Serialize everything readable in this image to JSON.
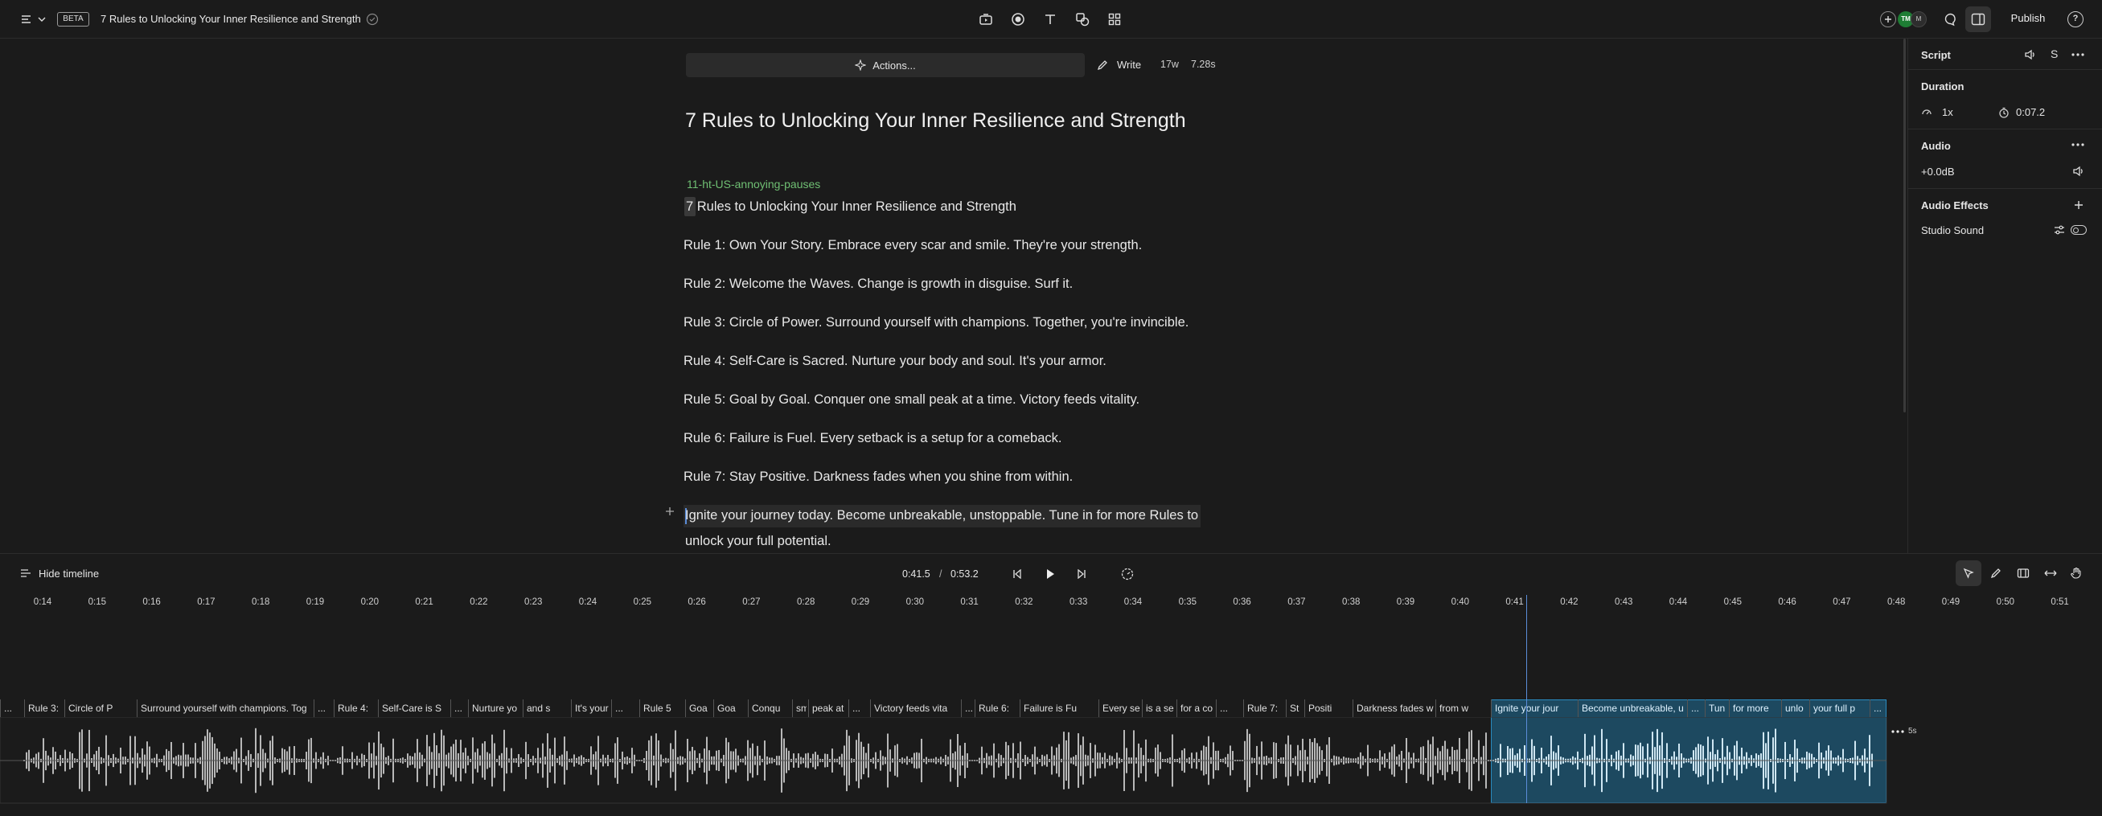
{
  "header": {
    "beta_badge": "BETA",
    "doc_title": "7 Rules to Unlocking Your Inner Resilience and Strength",
    "avatar1": "TM",
    "avatar2": "M",
    "publish_label": "Publish",
    "help_label": "?"
  },
  "actionbar": {
    "actions_label": "Actions...",
    "write_label": "Write",
    "word_count": "17w",
    "duration": "7.28s"
  },
  "document": {
    "title": "7 Rules to Unlocking Your Inner Resilience and Strength",
    "speaker": "11-ht-US-annoying-pauses",
    "lines": [
      "7 Rules to Unlocking Your Inner Resilience and Strength",
      "Rule 1: Own Your Story. Embrace every scar and smile. They're your strength.",
      "Rule 2: Welcome the Waves. Change is growth in disguise. Surf it.",
      "Rule 3: Circle of Power. Surround yourself with champions. Together, you're invincible.",
      "Rule 4: Self-Care is Sacred. Nurture your body and soul. It's your armor.",
      "Rule 5: Goal by Goal. Conquer one small peak at a time. Victory feeds vitality.",
      "Rule 6: Failure is Fuel. Every setback is a setup for a comeback.",
      "Rule 7: Stay Positive. Darkness fades when you shine from within."
    ],
    "last_line_1": "Ignite your journey today. Become unbreakable, unstoppable. Tune in for more Rules to",
    "last_line_2": "unlock your full potential."
  },
  "rightpanel": {
    "script_label": "Script",
    "s_label": "S",
    "duration_label": "Duration",
    "speed": "1x",
    "time": "0:07.2",
    "audio_label": "Audio",
    "gain": "+0.0dB",
    "effects_label": "Audio Effects",
    "studio_sound": "Studio Sound"
  },
  "timeline": {
    "hide_label": "Hide timeline",
    "current_time": "0:41.5",
    "separator": "/",
    "total_time": "0:53.2",
    "end_label": "5s",
    "ticks": [
      "0:14",
      "0:15",
      "0:16",
      "0:17",
      "0:18",
      "0:19",
      "0:20",
      "0:21",
      "0:22",
      "0:23",
      "0:24",
      "0:25",
      "0:26",
      "0:27",
      "0:28",
      "0:29",
      "0:30",
      "0:31",
      "0:32",
      "0:33",
      "0:34",
      "0:35",
      "0:36",
      "0:37",
      "0:38",
      "0:39",
      "0:40",
      "0:41",
      "0:42",
      "0:43",
      "0:44",
      "0:45",
      "0:46",
      "0:47",
      "0:48",
      "0:49",
      "0:50",
      "0:51"
    ],
    "segments": [
      "...",
      "Rule 3:",
      "Circle of P",
      "Surround yourself with champions. Tog",
      "...",
      "Rule 4:",
      "Self-Care is S",
      "...",
      "Nurture yo",
      "and s",
      "It's your",
      "...",
      "Rule 5",
      "Goa",
      "Goa",
      "Conqu",
      "sm",
      "peak at a",
      "...",
      "Victory feeds vita",
      "...",
      "Rule 6:",
      "Failure is Fu",
      "Every se",
      "is a se",
      "for a co",
      "...",
      "Rule 7:",
      "St",
      "Positi",
      "Darkness fades w",
      "from w",
      "Ignite your jour",
      "Become unbreakable, u",
      "...",
      "Tun",
      "for more",
      "unlo",
      "your full p",
      "..."
    ]
  },
  "colors": {
    "background": "#1b1b1b",
    "speaker_green": "#6fbf73",
    "selection_blue": "#1f6f99",
    "playhead": "#5b8dd9",
    "avatar_green": "#1e7d34"
  }
}
